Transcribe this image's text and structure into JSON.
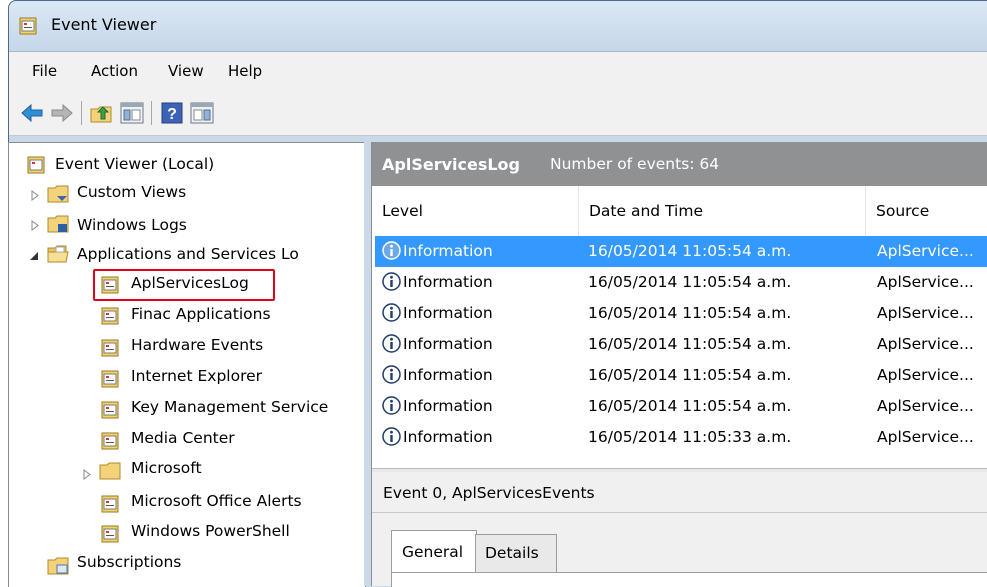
{
  "window": {
    "title": "Event Viewer"
  },
  "menu": [
    "File",
    "Action",
    "View",
    "Help"
  ],
  "tree": {
    "root": "Event Viewer (Local)",
    "custom_views": "Custom Views",
    "windows_logs": "Windows Logs",
    "apps_services": "Applications and Services Lo",
    "children": [
      "AplServicesLog",
      "Finac Applications",
      "Hardware Events",
      "Internet Explorer",
      "Key Management Service",
      "Media Center",
      "Microsoft",
      "Microsoft Office Alerts",
      "Windows PowerShell"
    ],
    "subscriptions": "Subscriptions"
  },
  "log": {
    "name": "AplServicesLog",
    "count_text": "Number of events: 64"
  },
  "columns": [
    "Level",
    "Date and Time",
    "Source"
  ],
  "events": [
    {
      "level": "Information",
      "datetime": "16/05/2014 11:05:54 a.m.",
      "source": "AplService..."
    },
    {
      "level": "Information",
      "datetime": "16/05/2014 11:05:54 a.m.",
      "source": "AplService..."
    },
    {
      "level": "Information",
      "datetime": "16/05/2014 11:05:54 a.m.",
      "source": "AplService..."
    },
    {
      "level": "Information",
      "datetime": "16/05/2014 11:05:54 a.m.",
      "source": "AplService..."
    },
    {
      "level": "Information",
      "datetime": "16/05/2014 11:05:54 a.m.",
      "source": "AplService..."
    },
    {
      "level": "Information",
      "datetime": "16/05/2014 11:05:54 a.m.",
      "source": "AplService..."
    },
    {
      "level": "Information",
      "datetime": "16/05/2014 11:05:33 a.m.",
      "source": "AplService..."
    }
  ],
  "detail": {
    "title": "Event 0, AplServicesEvents",
    "tabs": [
      "General",
      "Details"
    ]
  },
  "icons": {
    "app": "event-viewer-icon",
    "back": "back-arrow-icon",
    "forward": "forward-arrow-icon",
    "folder_up": "folder-up-icon",
    "show_hide_tree": "console-tree-icon",
    "help": "help-icon",
    "action_pane": "action-pane-icon",
    "info": "information-icon"
  },
  "colors": {
    "selection": "#3399ff",
    "header": "#8f9193",
    "highlight_box": "#e3001b"
  }
}
